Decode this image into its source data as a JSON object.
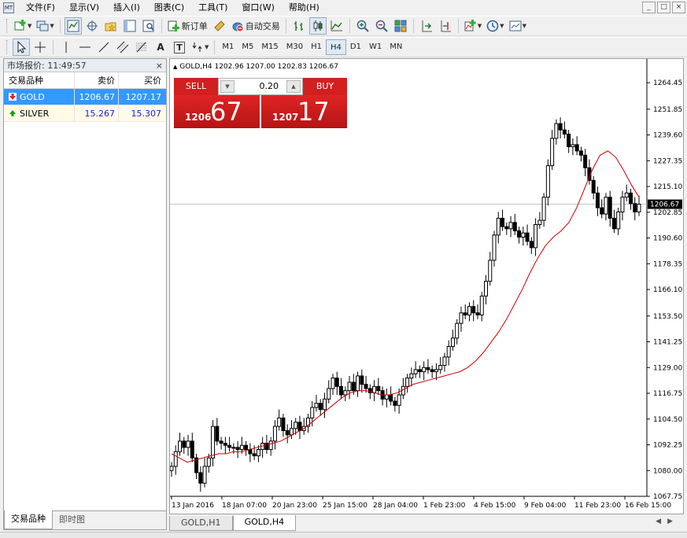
{
  "menu": {
    "items": [
      "文件(F)",
      "显示(V)",
      "插入(I)",
      "图表(C)",
      "工具(T)",
      "窗口(W)",
      "帮助(H)"
    ],
    "window_controls": [
      "_",
      "□",
      "×"
    ]
  },
  "toolbar": {
    "new_order": "新订单",
    "auto_trading": "自动交易",
    "text_tool": "A",
    "label_tool": "T",
    "timeframes": [
      "M1",
      "M5",
      "M15",
      "M30",
      "H1",
      "H4",
      "D1",
      "W1",
      "MN"
    ],
    "active_timeframe": "H4"
  },
  "market_watch": {
    "title": "市场报价: 11:49:57",
    "columns": {
      "symbol": "交易品种",
      "bid": "卖价",
      "ask": "买价"
    },
    "rows": [
      {
        "symbol": "GOLD",
        "bid": "1206.67",
        "ask": "1207.17",
        "direction": "down"
      },
      {
        "symbol": "SILVER",
        "bid": "15.267",
        "ask": "15.307",
        "direction": "up"
      }
    ],
    "tabs": [
      "交易品种",
      "即时图"
    ]
  },
  "chart": {
    "header": "GOLD,H4  1202.96 1207.00 1202.83 1206.67",
    "one_click": {
      "sell_label": "SELL",
      "buy_label": "BUY",
      "volume": "0.20",
      "sell_price_small": "1206",
      "sell_price_big": "67",
      "buy_price_small": "1207",
      "buy_price_big": "17"
    },
    "current_price_label": "1206.67",
    "y_ticks": [
      "1264.45",
      "1251.85",
      "1239.60",
      "1227.35",
      "1215.10",
      "1202.85",
      "1190.60",
      "1178.35",
      "1166.10",
      "1153.50",
      "1141.25",
      "1129.00",
      "1116.75",
      "1104.50",
      "1092.25",
      "1080.00",
      "1067.75"
    ],
    "x_ticks": [
      "13 Jan 2016",
      "18 Jan 07:00",
      "20 Jan 23:00",
      "25 Jan 15:00",
      "28 Jan 04:00",
      "1 Feb 23:00",
      "4 Feb 15:00",
      "9 Feb 04:00",
      "11 Feb 23:00",
      "16 Feb 15:00"
    ],
    "tabs": [
      "GOLD,H1",
      "GOLD,H4"
    ],
    "active_tab": "GOLD,H4",
    "colors": {
      "ma": "#cc0000",
      "candle": "#000000",
      "sell_button": "#d21f1f"
    }
  },
  "chart_data": {
    "type": "candlestick",
    "symbol": "GOLD",
    "timeframe": "H4",
    "ylim": [
      1067.75,
      1269
    ],
    "closes": [
      1082,
      1089,
      1094,
      1091,
      1094,
      1086,
      1079,
      1074,
      1082,
      1086,
      1101,
      1094,
      1093,
      1092,
      1091,
      1091,
      1090,
      1092,
      1090,
      1088,
      1087,
      1090,
      1093,
      1090,
      1094,
      1101,
      1105,
      1099,
      1097,
      1100,
      1103,
      1099,
      1101,
      1105,
      1110,
      1112,
      1109,
      1114,
      1119,
      1124,
      1120,
      1116,
      1118,
      1122,
      1118,
      1125,
      1121,
      1119,
      1117,
      1120,
      1118,
      1114,
      1116,
      1113,
      1111,
      1116,
      1120,
      1124,
      1126,
      1128,
      1127,
      1129,
      1128,
      1127,
      1128,
      1130,
      1134,
      1139,
      1143,
      1150,
      1155,
      1154,
      1158,
      1155,
      1154,
      1163,
      1170,
      1180,
      1192,
      1200,
      1196,
      1195,
      1198,
      1194,
      1191,
      1193,
      1189,
      1186,
      1197,
      1199,
      1210,
      1225,
      1238,
      1245,
      1242,
      1240,
      1234,
      1235,
      1232,
      1230,
      1224,
      1218,
      1212,
      1205,
      1202,
      1210,
      1200,
      1195,
      1203,
      1210,
      1212,
      1207,
      1203,
      1206.67
    ],
    "ma_period_label": "",
    "ma_values": [
      1088,
      1086,
      1084,
      1085,
      1086,
      1087,
      1088,
      1088,
      1089,
      1089,
      1090,
      1091,
      1092,
      1093,
      1094,
      1096,
      1098,
      1100,
      1103,
      1106,
      1109,
      1112,
      1115,
      1117,
      1118,
      1118,
      1117,
      1116,
      1116,
      1117,
      1119,
      1121,
      1122,
      1123,
      1124,
      1125,
      1126,
      1127,
      1129,
      1132,
      1136,
      1141,
      1146,
      1152,
      1159,
      1166,
      1174,
      1181,
      1187,
      1191,
      1194,
      1198,
      1205,
      1214,
      1223,
      1230,
      1232,
      1229,
      1223,
      1216,
      1210
    ]
  }
}
